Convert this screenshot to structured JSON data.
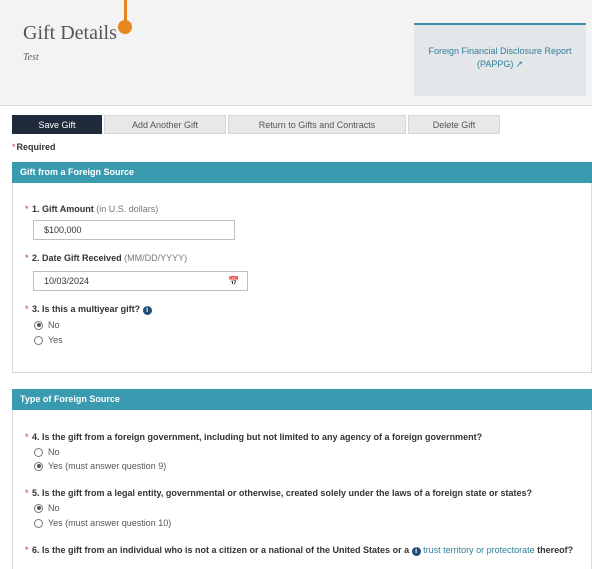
{
  "header": {
    "title": "Gift Details",
    "subtitle": "Test",
    "report_link": "Foreign Financial Disclosure Report (PAPPG)"
  },
  "toolbar": {
    "buttons": [
      "Save Gift",
      "Add Another Gift",
      "Return to Gifts and Contracts",
      "Delete Gift"
    ]
  },
  "required_label": "Required",
  "section1": {
    "title": "Gift from a Foreign Source",
    "q1": {
      "label": "1. Gift Amount",
      "hint": "(in U.S. dollars)",
      "value": "$100,000"
    },
    "q2": {
      "label": "2. Date Gift Received",
      "hint": "(MM/DD/YYYY)",
      "value": "10/03/2024"
    },
    "q3": {
      "label": "3. Is this a multiyear gift?",
      "options": [
        "No",
        "Yes"
      ],
      "selected": "No"
    }
  },
  "section2": {
    "title": "Type of Foreign Source",
    "q4": {
      "label": "4. Is the gift from a foreign government, including but not limited to any agency of a foreign government?",
      "options": [
        "No",
        "Yes (must answer question 9)"
      ],
      "selected": "Yes (must answer question 9)"
    },
    "q5": {
      "label": "5. Is the gift from a legal entity, governmental or otherwise, created solely under the laws of a foreign state or states?",
      "options": [
        "No",
        "Yes (must answer question 10)"
      ],
      "selected": "No"
    },
    "q6": {
      "label_prefix": "6. Is the gift from an individual who is not a citizen or a national of the United States or a",
      "link": "trust territory or protectorate",
      "label_suffix": "thereof?"
    }
  },
  "colors": {
    "accent": "#3a9bb0",
    "primary_button": "#1f2a3a",
    "required": "#c53131",
    "link": "#2f7f98",
    "marker": "#e7861f"
  },
  "icons": [
    "external-link-icon",
    "calendar-icon",
    "info-icon"
  ]
}
